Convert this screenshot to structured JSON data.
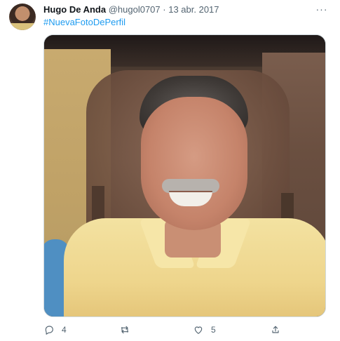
{
  "tweet": {
    "display_name": "Hugo De Anda",
    "handle": "@hugol0707",
    "separator": "·",
    "date": "13 abr. 2017",
    "hashtag": "#NuevaFotoDePerfil",
    "more_icon": "more-horizontal-icon"
  },
  "media": {
    "description": "profile-photo",
    "alt": ""
  },
  "actions": {
    "reply": {
      "icon": "reply-icon",
      "count": "4"
    },
    "retweet": {
      "icon": "retweet-icon",
      "count": ""
    },
    "like": {
      "icon": "like-icon",
      "count": "5"
    },
    "share": {
      "icon": "share-icon",
      "count": ""
    }
  },
  "colors": {
    "text": "#0f1419",
    "secondary": "#536471",
    "link": "#1d9bf0",
    "border": "#cfd9de"
  }
}
